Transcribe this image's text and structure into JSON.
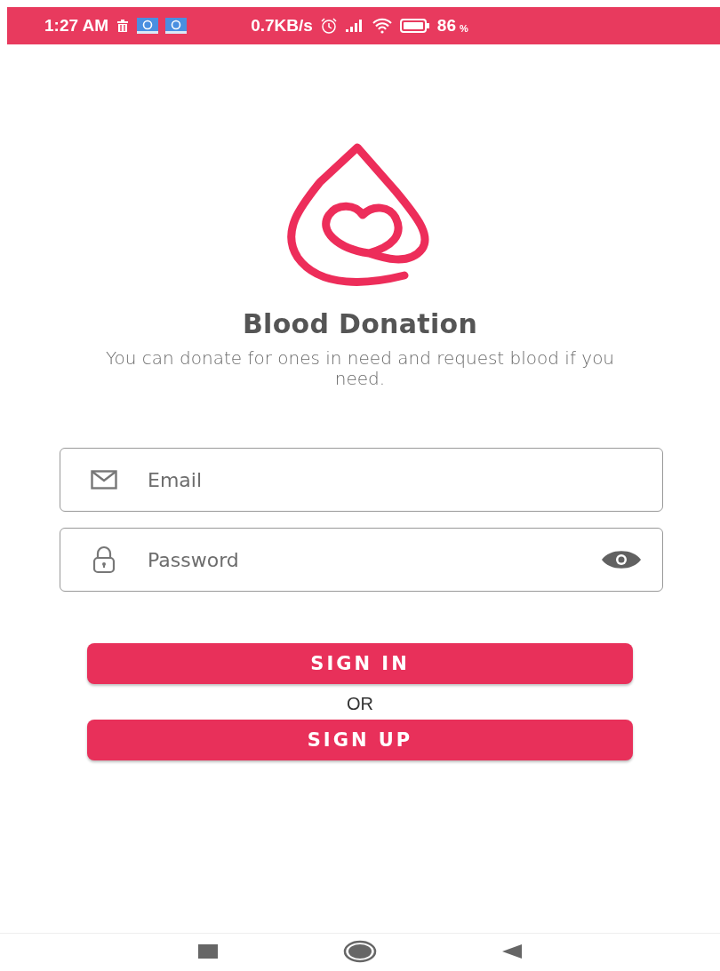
{
  "status_bar": {
    "time": "1:27 AM",
    "speed": "0.7KB/s",
    "battery": "86",
    "battery_unit": "%"
  },
  "app": {
    "title": "Blood Donation",
    "subtitle": "You can donate for ones in need and request blood if you need."
  },
  "email_field": {
    "placeholder": "Email"
  },
  "password_field": {
    "placeholder": "Password"
  },
  "sign_in_button": "SIGN IN",
  "separator": "OR",
  "sign_up_button": "SIGN UP"
}
